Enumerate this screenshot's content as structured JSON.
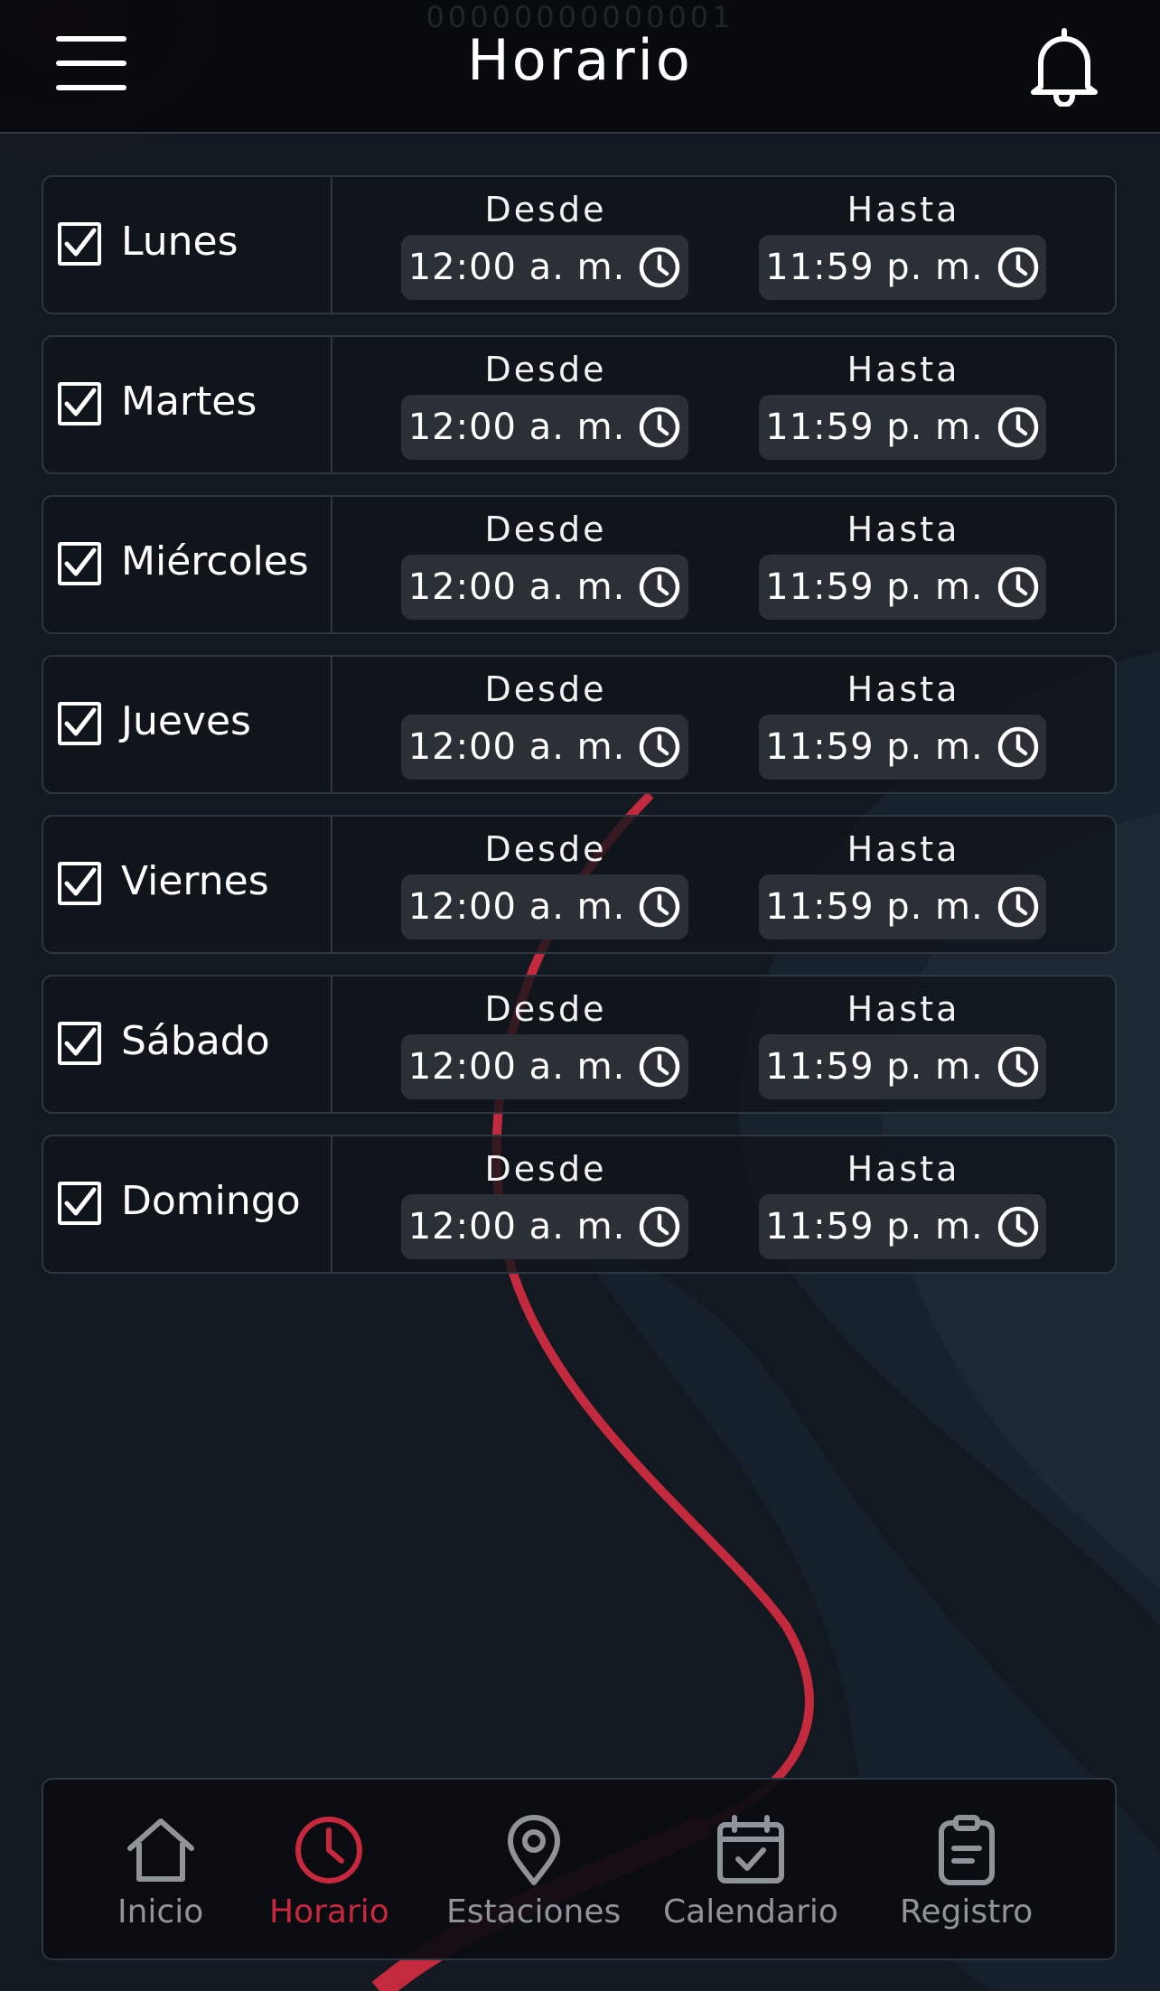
{
  "header": {
    "title": "Horario",
    "serial": "00000000000001",
    "menu_icon": "hamburger-menu-icon",
    "bell_icon": "bell-icon"
  },
  "days": [
    {
      "name": "Lunes",
      "checked": true,
      "from_label": "Desde",
      "from": "12:00 a. m.",
      "to_label": "Hasta",
      "to": "11:59 p. m."
    },
    {
      "name": "Martes",
      "checked": true,
      "from_label": "Desde",
      "from": "12:00 a. m.",
      "to_label": "Hasta",
      "to": "11:59 p. m."
    },
    {
      "name": "Miércoles",
      "checked": true,
      "from_label": "Desde",
      "from": "12:00 a. m.",
      "to_label": "Hasta",
      "to": "11:59 p. m."
    },
    {
      "name": "Jueves",
      "checked": true,
      "from_label": "Desde",
      "from": "12:00 a. m.",
      "to_label": "Hasta",
      "to": "11:59 p. m."
    },
    {
      "name": "Viernes",
      "checked": true,
      "from_label": "Desde",
      "from": "12:00 a. m.",
      "to_label": "Hasta",
      "to": "11:59 p. m."
    },
    {
      "name": "Sábado",
      "checked": true,
      "from_label": "Desde",
      "from": "12:00 a. m.",
      "to_label": "Hasta",
      "to": "11:59 p. m."
    },
    {
      "name": "Domingo",
      "checked": true,
      "from_label": "Desde",
      "from": "12:00 a. m.",
      "to_label": "Hasta",
      "to": "11:59 p. m."
    }
  ],
  "nav": {
    "items": [
      {
        "label": "Inicio",
        "icon": "home-icon",
        "active": false
      },
      {
        "label": "Horario",
        "icon": "clock-icon",
        "active": true
      },
      {
        "label": "Estaciones",
        "icon": "location-pin-icon",
        "active": false
      },
      {
        "label": "Calendario",
        "icon": "calendar-check-icon",
        "active": false
      },
      {
        "label": "Registro",
        "icon": "clipboard-icon",
        "active": false
      }
    ]
  },
  "colors": {
    "background": "#131a22",
    "accent": "#c7283d",
    "inactive": "#8f949a",
    "field": "#2b3036",
    "border": "#2e3740"
  }
}
